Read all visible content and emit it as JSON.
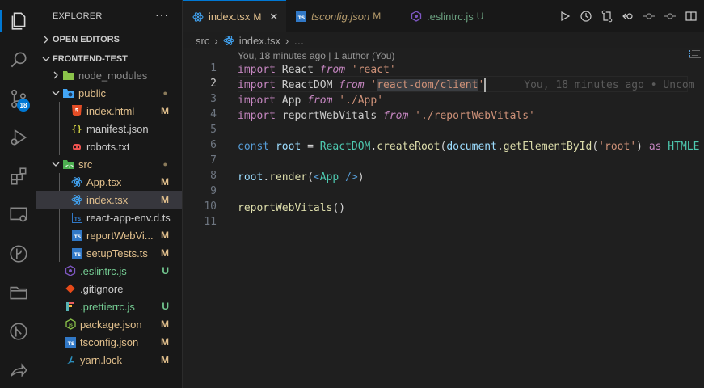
{
  "sidebar": {
    "title": "EXPLORER",
    "more": "···",
    "open_editors": "OPEN EDITORS",
    "project": "FRONTEND-TEST",
    "tree": [
      {
        "label": "node_modules",
        "status": ""
      },
      {
        "label": "public",
        "status": "●"
      },
      {
        "label": "index.html",
        "status": "M"
      },
      {
        "label": "manifest.json",
        "status": ""
      },
      {
        "label": "robots.txt",
        "status": ""
      },
      {
        "label": "src",
        "status": "●"
      },
      {
        "label": "App.tsx",
        "status": "M"
      },
      {
        "label": "index.tsx",
        "status": "M"
      },
      {
        "label": "react-app-env.d.ts",
        "status": ""
      },
      {
        "label": "reportWebVi...",
        "status": "M"
      },
      {
        "label": "setupTests.ts",
        "status": "M"
      },
      {
        "label": ".eslintrc.js",
        "status": "U"
      },
      {
        "label": ".gitignore",
        "status": ""
      },
      {
        "label": ".prettierrc.js",
        "status": "U"
      },
      {
        "label": "package.json",
        "status": "M"
      },
      {
        "label": "tsconfig.json",
        "status": "M"
      },
      {
        "label": "yarn.lock",
        "status": "M"
      }
    ]
  },
  "activity": {
    "scm_badge": "18"
  },
  "tabs": [
    {
      "label": "index.tsx",
      "status": "M",
      "close": "✕"
    },
    {
      "label": "tsconfig.json",
      "status": "M"
    },
    {
      "label": ".eslintrc.js",
      "status": "U"
    }
  ],
  "breadcrumb": {
    "folder": "src",
    "sep": "›",
    "file": "index.tsx",
    "tail": "…"
  },
  "editor": {
    "codelens": "You, 18 minutes ago | 1 author (You)",
    "line_numbers": [
      "1",
      "2",
      "3",
      "4",
      "5",
      "6",
      "7",
      "8",
      "9",
      "10",
      "11"
    ],
    "blame": "You, 18 minutes ago • Uncom"
  },
  "colors": {
    "accent": "#0078d4",
    "modified": "#e2c08d",
    "untracked": "#73c991"
  }
}
